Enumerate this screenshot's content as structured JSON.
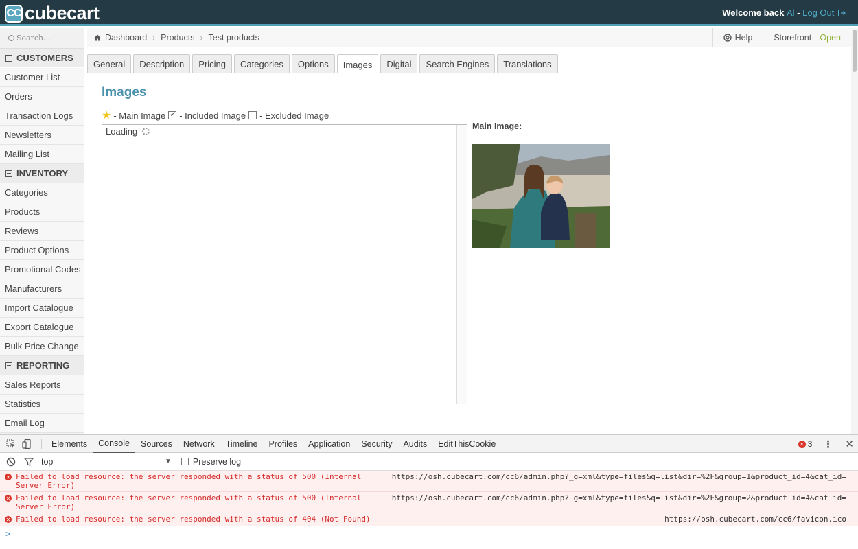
{
  "header": {
    "logo_badge": "CC",
    "logo_text": "cubecart",
    "welcome": "Welcome back",
    "user": "Al",
    "dash": "-",
    "logout": "Log Out"
  },
  "search": {
    "placeholder": "Search..."
  },
  "sidebar": {
    "customers": {
      "title": "CUSTOMERS",
      "items": [
        "Customer List",
        "Orders",
        "Transaction Logs",
        "Newsletters",
        "Mailing List"
      ]
    },
    "inventory": {
      "title": "INVENTORY",
      "items": [
        "Categories",
        "Products",
        "Reviews",
        "Product Options",
        "Promotional Codes",
        "Manufacturers",
        "Import Catalogue",
        "Export Catalogue",
        "Bulk Price Change"
      ]
    },
    "reporting": {
      "title": "REPORTING",
      "items": [
        "Sales Reports",
        "Statistics",
        "Email Log"
      ]
    }
  },
  "breadcrumb": {
    "items": [
      "Dashboard",
      "Products",
      "Test products"
    ],
    "help": "Help",
    "storefront": "Storefront",
    "storefront_sep": "-",
    "open": "Open"
  },
  "tabs": [
    "General",
    "Description",
    "Pricing",
    "Categories",
    "Options",
    "Images",
    "Digital",
    "Search Engines",
    "Translations"
  ],
  "active_tab": "Images",
  "content": {
    "heading": "Images",
    "legend_main": "- Main Image",
    "legend_included": "- Included Image",
    "legend_excluded": "- Excluded Image",
    "loading": "Loading",
    "main_image_label": "Main Image:"
  },
  "devtools": {
    "tabs": [
      "Elements",
      "Console",
      "Sources",
      "Network",
      "Timeline",
      "Profiles",
      "Application",
      "Security",
      "Audits",
      "EditThisCookie"
    ],
    "active_tab": "Console",
    "error_count": "3",
    "context": "top",
    "preserve_log": "Preserve log",
    "errors": [
      {
        "message": "Failed to load resource: the server responded with a status of 500 (Internal Server Error)",
        "url": "https://osh.cubecart.com/cc6/admin.php?_g=xml&type=files&q=list&dir=%2F&group=1&product_id=4&cat_id="
      },
      {
        "message": "Failed to load resource: the server responded with a status of 500 (Internal Server Error)",
        "url": "https://osh.cubecart.com/cc6/admin.php?_g=xml&type=files&q=list&dir=%2F&group=2&product_id=4&cat_id="
      },
      {
        "message": "Failed to load resource: the server responded with a status of 404 (Not Found)",
        "url": "https://osh.cubecart.com/cc6/favicon.ico"
      }
    ],
    "prompt": ">"
  },
  "colors": {
    "header_bg": "#243a44",
    "accent": "#4fa9c6",
    "heading": "#4d92ad",
    "open": "#8fb339",
    "error": "#d52b2b"
  }
}
